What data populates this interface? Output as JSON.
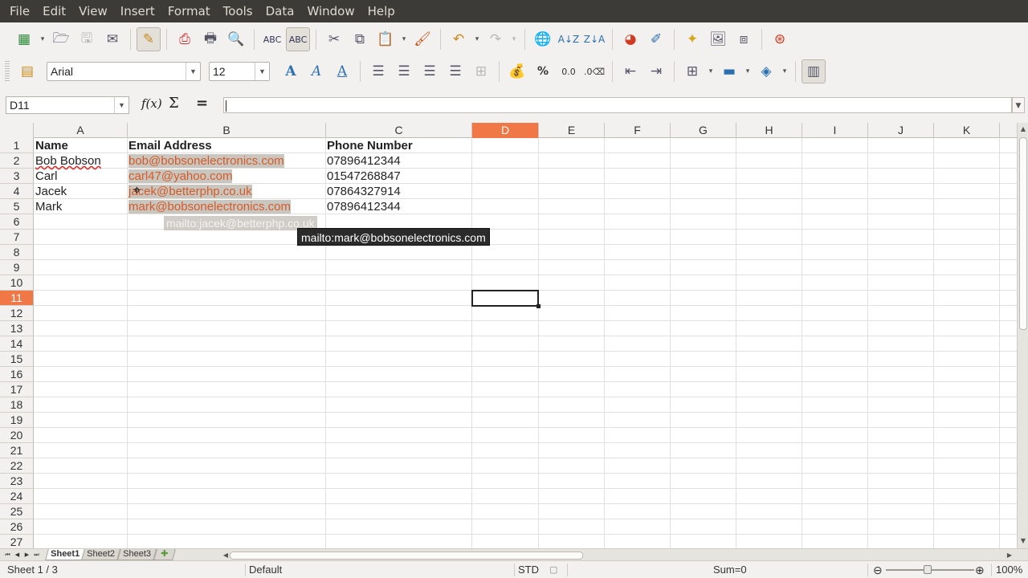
{
  "menu": [
    "File",
    "Edit",
    "View",
    "Insert",
    "Format",
    "Tools",
    "Data",
    "Window",
    "Help"
  ],
  "toolbar2": {
    "font_name": "Arial",
    "font_size": "12",
    "percent": "%",
    "decimal": "0.0"
  },
  "formula_bar": {
    "cell_ref": "D11",
    "fx": "f(x)",
    "sum": "Σ",
    "equals": "="
  },
  "columns": [
    "A",
    "B",
    "C",
    "D",
    "E",
    "F",
    "G",
    "H",
    "I",
    "J",
    "K"
  ],
  "selected_column": "D",
  "rows": [
    "1",
    "2",
    "3",
    "4",
    "5",
    "6",
    "7",
    "8",
    "9",
    "10",
    "11",
    "12",
    "13",
    "14",
    "15",
    "16",
    "17",
    "18",
    "19",
    "20",
    "21",
    "22",
    "23",
    "24",
    "25",
    "26",
    "27"
  ],
  "selected_row": "11",
  "sheet": {
    "headers": [
      "Name",
      "Email Address",
      "Phone Number"
    ],
    "records": [
      {
        "name": "Bob Bobson",
        "email": "bob@bobsonelectronics.com",
        "phone": "07896412344"
      },
      {
        "name": "Carl",
        "email": "carl47@yahoo.com",
        "phone": "01547268847"
      },
      {
        "name": "Jacek",
        "email": "jacek@betterphp.co.uk",
        "phone": "07864327914"
      },
      {
        "name": "Mark",
        "email": "mark@bobsonelectronics.com",
        "phone": "07896412344"
      }
    ]
  },
  "tooltip": "mailto:mark@bobsonelectronics.com",
  "ghost_tooltip": "mailto:jacek@betterphp.co.uk",
  "tabs": [
    "Sheet1",
    "Sheet2",
    "Sheet3"
  ],
  "active_tab": "Sheet1",
  "status": {
    "sheet": "Sheet 1 / 3",
    "style": "Default",
    "mode": "STD",
    "sum": "Sum=0",
    "zoom": "100%"
  }
}
